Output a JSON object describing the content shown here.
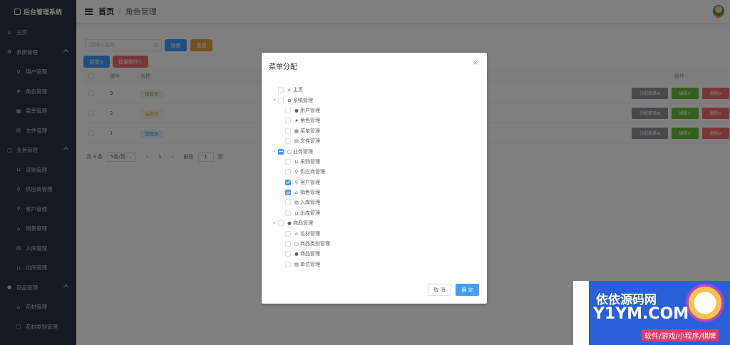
{
  "app": {
    "title": "后台管理系统"
  },
  "sidebar": {
    "items": [
      {
        "label": "主页",
        "icon": "home-icon",
        "sub": false
      },
      {
        "label": "系统管理",
        "icon": "gear-icon",
        "sub": false,
        "group": true
      },
      {
        "label": "用户管理",
        "icon": "user-icon",
        "sub": true
      },
      {
        "label": "角色管理",
        "icon": "star-icon",
        "sub": true
      },
      {
        "label": "菜单管理",
        "icon": "grid-icon",
        "sub": true
      },
      {
        "label": "文件管理",
        "icon": "document-icon",
        "sub": true
      },
      {
        "label": "业务管理",
        "icon": "folder-icon",
        "sub": false,
        "group": true
      },
      {
        "label": "采购管理",
        "icon": "cart-icon",
        "sub": true
      },
      {
        "label": "供应商管理",
        "icon": "user-icon",
        "sub": true
      },
      {
        "label": "客户管理",
        "icon": "user-icon",
        "sub": true
      },
      {
        "label": "销售管理",
        "icon": "bag-icon",
        "sub": true
      },
      {
        "label": "入库管理",
        "icon": "document-icon",
        "sub": true
      },
      {
        "label": "出库管理",
        "icon": "cart-icon",
        "sub": true
      },
      {
        "label": "商品管理",
        "icon": "goods-icon",
        "sub": false,
        "group": true
      },
      {
        "label": "花材管理",
        "icon": "bag-icon",
        "sub": true
      },
      {
        "label": "花材类别管理",
        "icon": "folder-icon",
        "sub": true
      }
    ]
  },
  "header": {
    "home": "首页",
    "separator": "/",
    "current": "角色管理"
  },
  "toolbar": {
    "search_placeholder": "请输入名称",
    "search_btn": "搜索",
    "reset_btn": "重置",
    "add_btn": "新增⊙",
    "batch_delete_btn": "批量删除⊙"
  },
  "table": {
    "headers": {
      "id": "编号",
      "name": "名称",
      "ops": "操作"
    },
    "rows": [
      {
        "id": "3",
        "name": "销售员",
        "tag": "green"
      },
      {
        "id": "2",
        "name": "采购员",
        "tag": "orange"
      },
      {
        "id": "1",
        "name": "管理员",
        "tag": "blue"
      }
    ],
    "row_buttons": {
      "assign": "分配菜单⊞",
      "edit": "编辑✐",
      "delete": "删除⊖"
    }
  },
  "pager": {
    "total": "共 3 条",
    "size": "5条/页",
    "prev": "‹",
    "page": "1",
    "next": "›",
    "goto_label": "前往",
    "goto_value": "1",
    "goto_suffix": "页"
  },
  "dialog": {
    "title": "菜单分配",
    "close": "×",
    "tree": [
      {
        "label": "主页",
        "icon": "home-icon",
        "glyph": "⌂",
        "level": 0,
        "state": "none",
        "caret": false
      },
      {
        "label": "系统管理",
        "icon": "gear-icon",
        "glyph": "✿",
        "level": 0,
        "state": "none",
        "caret": true
      },
      {
        "label": "用户管理",
        "icon": "user-icon",
        "glyph": "●",
        "level": 1,
        "state": "none"
      },
      {
        "label": "角色管理",
        "icon": "star-icon",
        "glyph": "★",
        "level": 1,
        "state": "none"
      },
      {
        "label": "菜单管理",
        "icon": "grid-icon",
        "glyph": "▦",
        "level": 1,
        "state": "none"
      },
      {
        "label": "文件管理",
        "icon": "document-icon",
        "glyph": "▤",
        "level": 1,
        "state": "none"
      },
      {
        "label": "业务管理",
        "icon": "folder-icon",
        "glyph": "▢",
        "level": 0,
        "state": "indeterminate",
        "caret": true
      },
      {
        "label": "采购管理",
        "icon": "cart-icon",
        "glyph": "⊔",
        "level": 1,
        "state": "none"
      },
      {
        "label": "供应商管理",
        "icon": "user-icon",
        "glyph": "⚲",
        "level": 1,
        "state": "none"
      },
      {
        "label": "客户管理",
        "icon": "user-icon",
        "glyph": "⚲",
        "level": 1,
        "state": "checked"
      },
      {
        "label": "销售管理",
        "icon": "bag-icon",
        "glyph": "⌂",
        "level": 1,
        "state": "checked"
      },
      {
        "label": "入库管理",
        "icon": "document-icon",
        "glyph": "▤",
        "level": 1,
        "state": "none"
      },
      {
        "label": "出库管理",
        "icon": "cart-icon",
        "glyph": "⊔",
        "level": 1,
        "state": "none"
      },
      {
        "label": "商品管理",
        "icon": "goods-icon",
        "glyph": "●",
        "level": 0,
        "state": "none",
        "caret": true
      },
      {
        "label": "花材管理",
        "icon": "bag-icon",
        "glyph": "⌂",
        "level": 1,
        "state": "none"
      },
      {
        "label": "商品类别管理",
        "icon": "folder-icon",
        "glyph": "▢",
        "level": 1,
        "state": "none"
      },
      {
        "label": "商品管理",
        "icon": "goods-icon",
        "glyph": "●",
        "level": 1,
        "state": "none"
      },
      {
        "label": "单位管理",
        "icon": "document-icon",
        "glyph": "▤",
        "level": 1,
        "state": "none"
      }
    ],
    "cancel": "取 消",
    "ok": "确 定"
  },
  "watermark": {
    "cn": "依依源码网",
    "en": "Y1YM.COM",
    "sub": "软件/游戏/小程序/棋牌"
  }
}
